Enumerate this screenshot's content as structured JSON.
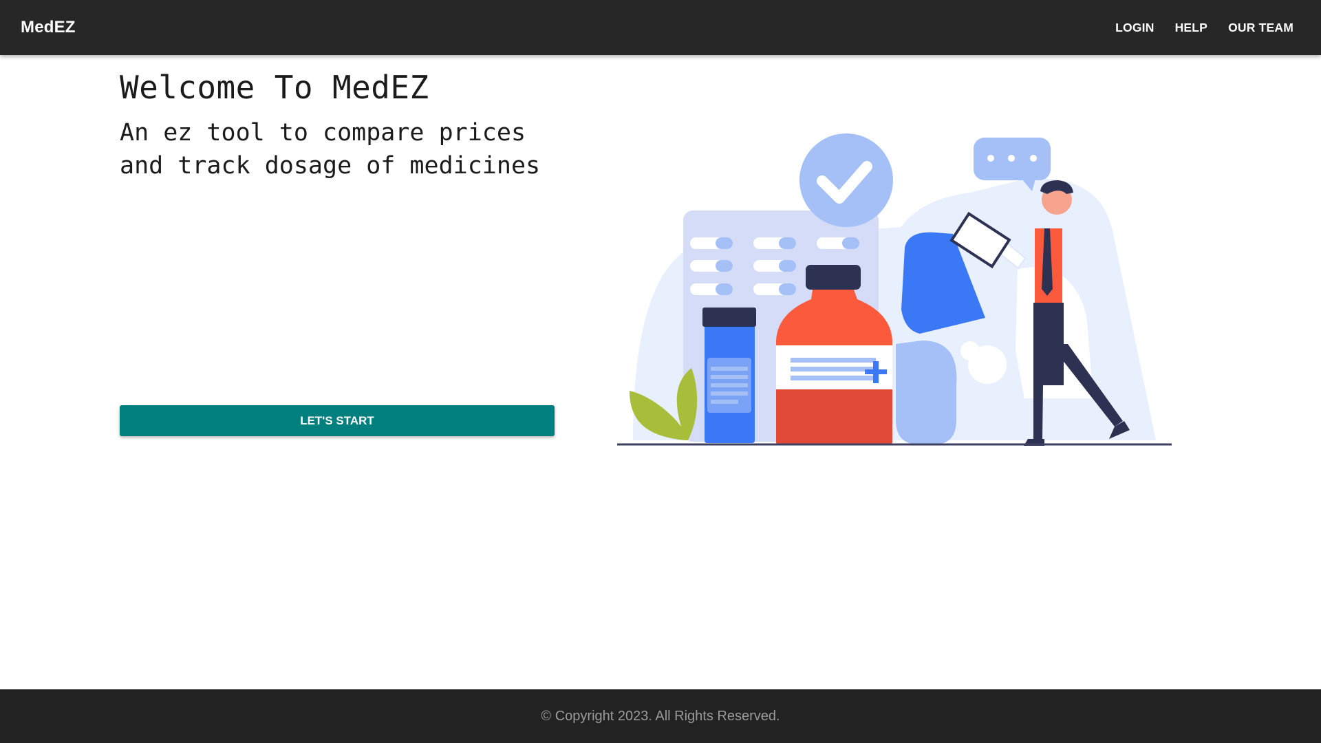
{
  "header": {
    "brand": "MedEZ",
    "nav": [
      "LOGIN",
      "HELP",
      "OUR TEAM"
    ]
  },
  "hero": {
    "title": "Welcome To MedEZ",
    "subtitle": "An ez tool to compare prices and track dosage of medicines",
    "cta_label": "LET'S START"
  },
  "illustration": {
    "icons": [
      "check-circle-icon",
      "speech-bubble-icon",
      "medicine-bottle-icon",
      "pill-bottle-icon",
      "capsule-icon",
      "doctor-figure",
      "plant-icon"
    ],
    "colors": {
      "accent_blue": "#3a78f5",
      "light_blue": "#a4c0f7",
      "orange": "#fb5b3c",
      "red": "#e04a36",
      "navy": "#2e3252",
      "plant_green": "#a8bd3a"
    }
  },
  "footer": {
    "copyright": "© Copyright 2023. All Rights Reserved."
  },
  "colors": {
    "header_bg": "#272727",
    "cta_bg": "#007f7f",
    "footer_bg": "#222222"
  }
}
